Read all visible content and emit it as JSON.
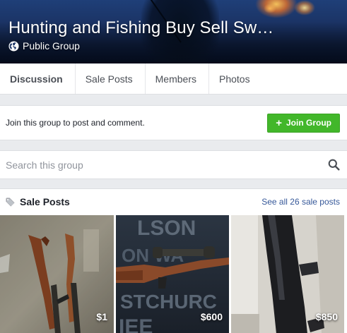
{
  "group": {
    "title": "Hunting and Fishing Buy Sell Sw…",
    "privacy": "Public Group"
  },
  "tabs": [
    {
      "label": "Discussion",
      "active": true
    },
    {
      "label": "Sale Posts",
      "active": false
    },
    {
      "label": "Members",
      "active": false
    },
    {
      "label": "Photos",
      "active": false
    }
  ],
  "join": {
    "prompt": "Join this group to post and comment.",
    "button_label": "Join Group",
    "button_color": "#42b72a"
  },
  "search": {
    "placeholder": "Search this group",
    "value": ""
  },
  "sale_posts": {
    "title": "Sale Posts",
    "see_all": "See all 26 sale posts",
    "items": [
      {
        "price": "$1",
        "image": "two-rifles-on-carpet"
      },
      {
        "price": "$600",
        "image": "scoped-rifle-on-jersey"
      },
      {
        "price": "$850",
        "image": "black-rifle-closeup"
      }
    ]
  },
  "icons": {
    "privacy": "globe-icon",
    "search": "search-icon",
    "sale": "tag-icon",
    "join": "plus-icon"
  },
  "colors": {
    "link": "#365899",
    "join_button": "#42b72a",
    "background": "#e9ebee"
  }
}
